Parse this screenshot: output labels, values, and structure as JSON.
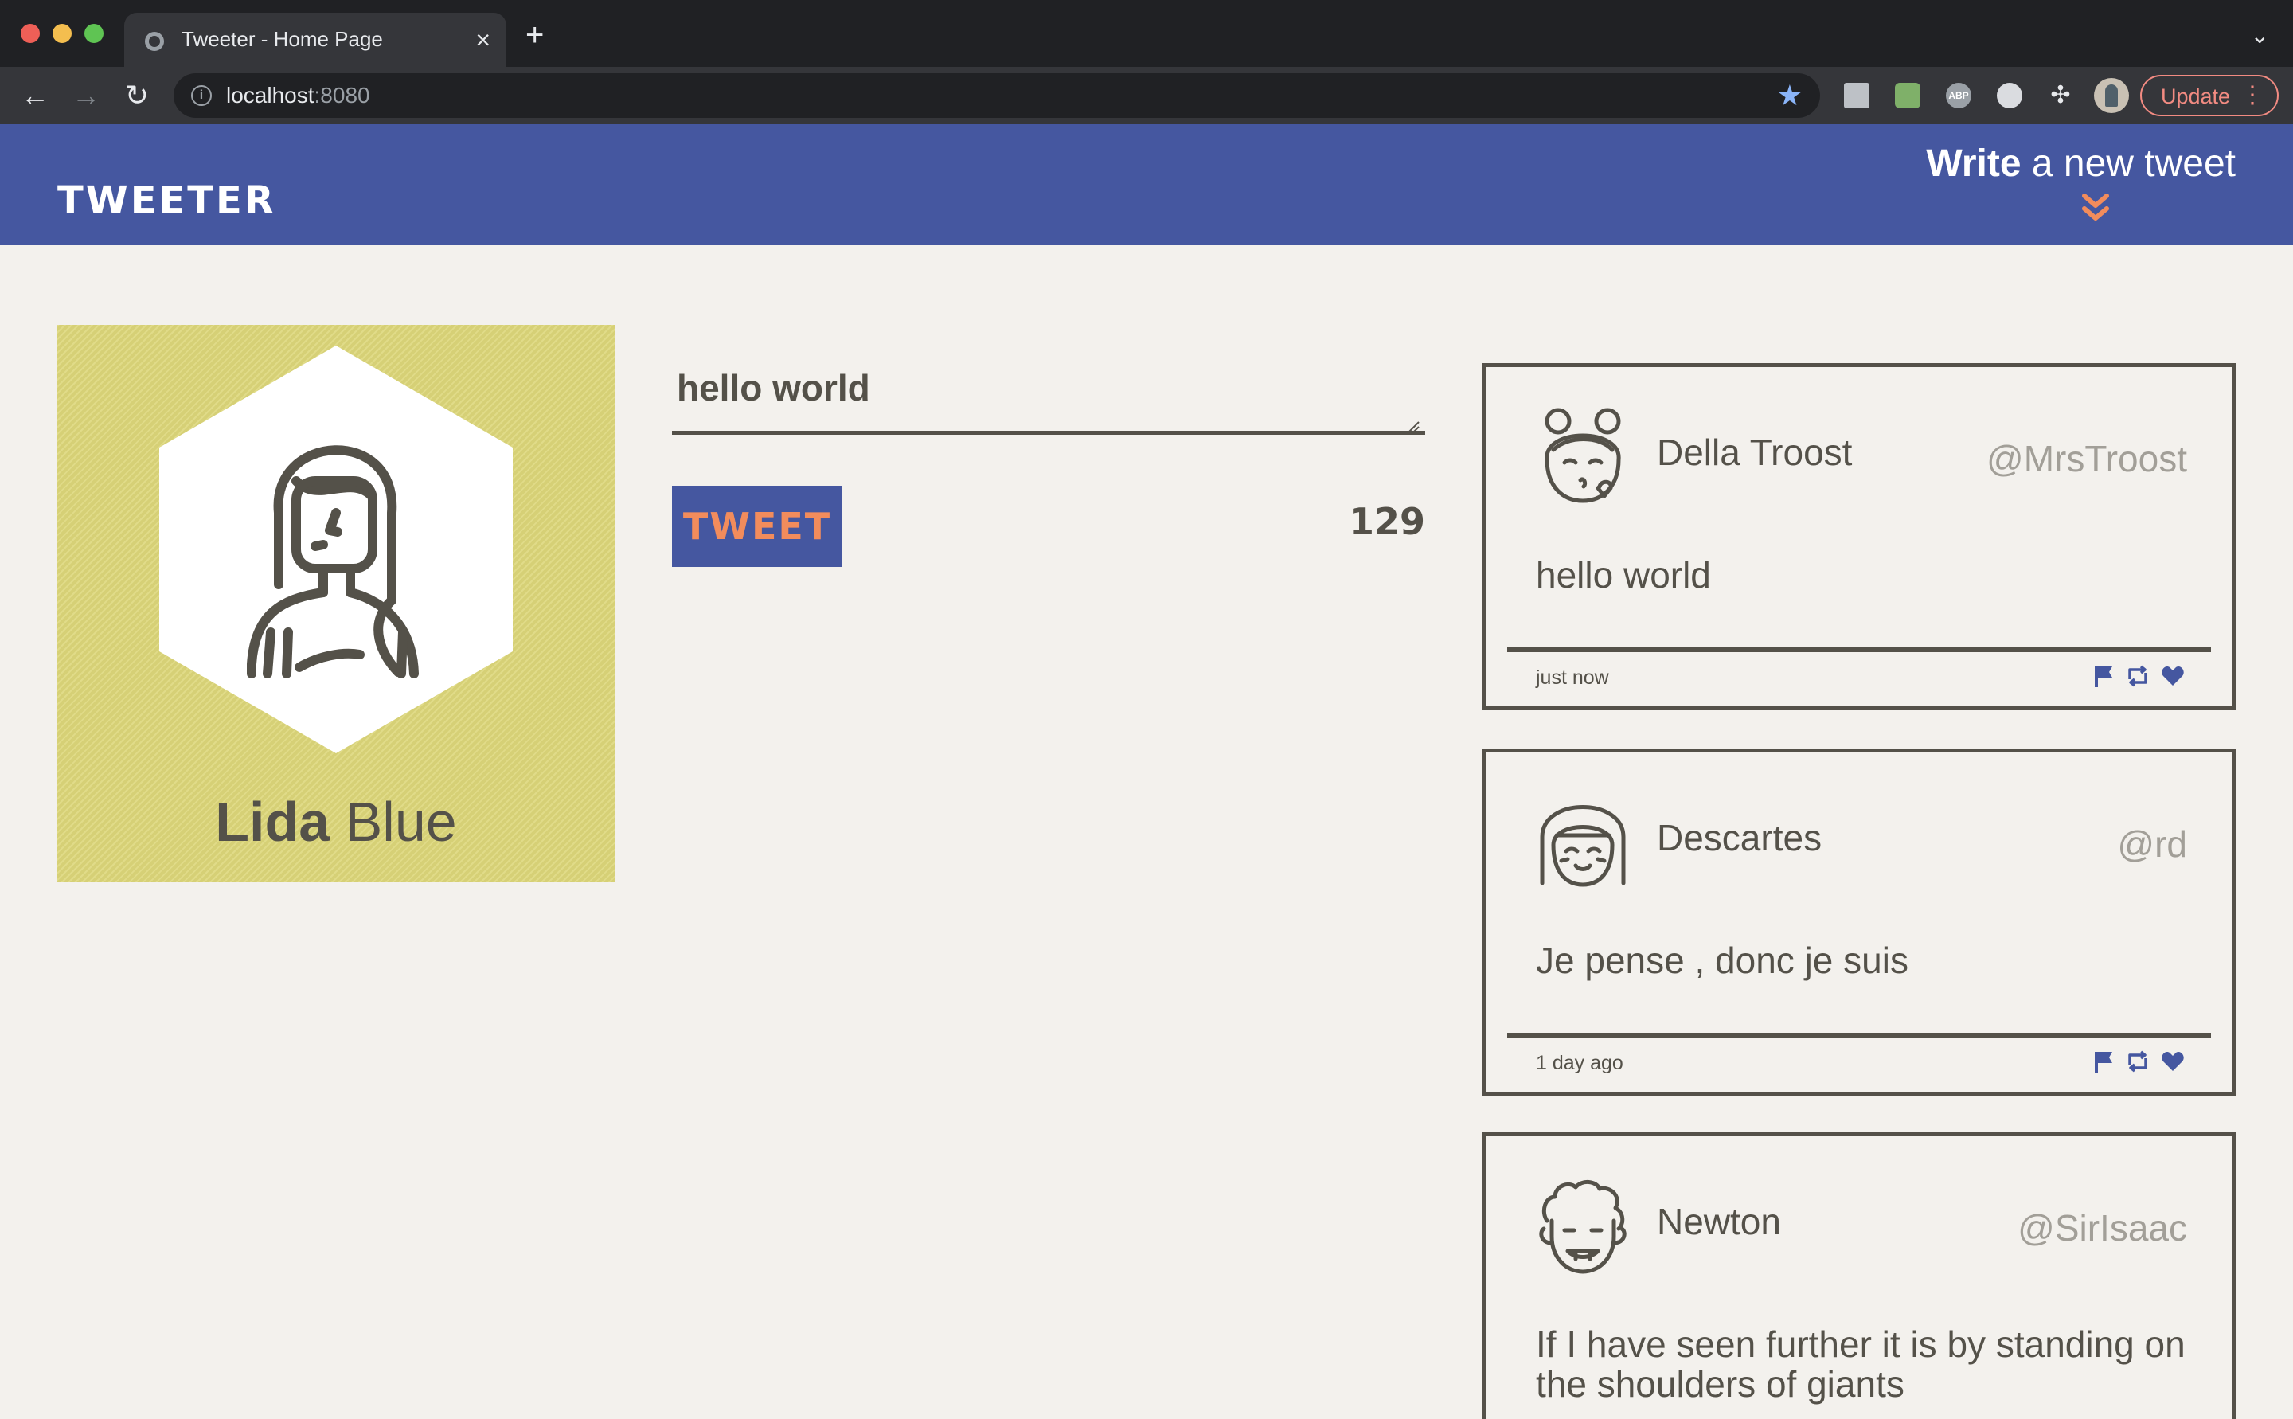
{
  "browser": {
    "tab_title": "Tweeter - Home Page",
    "url_host": "localhost",
    "url_port": ":8080",
    "update_label": "Update",
    "extensions": [
      "page-icon",
      "image-extension-icon",
      "adblock-icon",
      "ghostery-icon",
      "extensions-puzzle-icon"
    ]
  },
  "header": {
    "brand": "Tweeter",
    "compose_strong": "Write",
    "compose_rest": " a new tweet",
    "compose_icon": "double-chevron-down-icon"
  },
  "profile": {
    "first_name": "Lida",
    "last_name": " Blue",
    "avatar_icon": "woman-avatar-icon",
    "card_color": "#ddd77a"
  },
  "compose": {
    "input_value": "hello world",
    "button_label": "Tweet",
    "char_counter": "129"
  },
  "tweets": [
    {
      "name": "Della Troost",
      "handle": "@MrsTroost",
      "body": "hello world",
      "time": "just now",
      "avatar_icon": "kissing-girl-avatar-icon"
    },
    {
      "name": "Descartes",
      "handle": "@rd",
      "body": "Je pense , donc je suis",
      "time": "1 day ago",
      "avatar_icon": "smiling-girl-avatar-icon"
    },
    {
      "name": "Newton",
      "handle": "@SirIsaac",
      "body": "If I have seen further it is by standing on the shoulders of giants",
      "time": "",
      "avatar_icon": "curly-hair-man-avatar-icon"
    }
  ],
  "colors": {
    "header_bg": "#4557a0",
    "accent_orange": "#f28c5c",
    "page_bg": "#f3f1ed",
    "text_dark": "#545149",
    "handle_gray": "#a29f98"
  }
}
